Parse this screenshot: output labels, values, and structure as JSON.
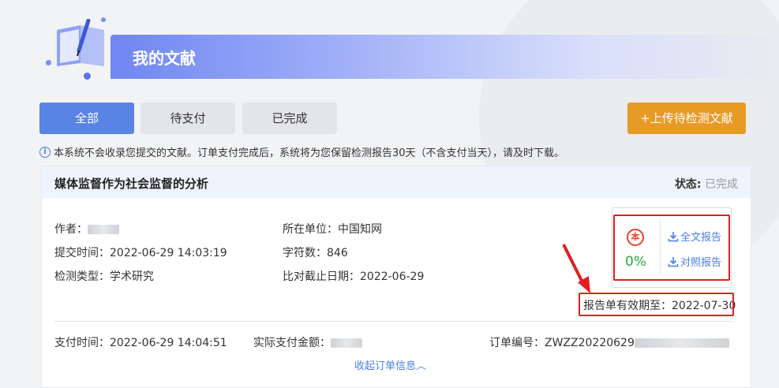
{
  "header": {
    "title": "我的文献"
  },
  "tabs": [
    {
      "label": "全部",
      "active": true
    },
    {
      "label": "待支付",
      "active": false
    },
    {
      "label": "已完成",
      "active": false
    }
  ],
  "upload_button": {
    "label": "+上传待检测文献"
  },
  "notice": {
    "text": "本系统不会收录您提交的文献。订单支付完成后，系统将为您保留检测报告30天（不含支付当天），请及时下载。"
  },
  "order": {
    "title": "媒体监督作为社会监督的分析",
    "status_label": "状态:",
    "status_value": "已完成",
    "author_label": "作者：",
    "org_label": "所在单位：",
    "org_value": "中国知网",
    "submit_time_label": "提交时间：",
    "submit_time_value": "2022-06-29 14:03:19",
    "char_count_label": "字符数：",
    "char_count_value": "846",
    "detect_type_label": "检测类型：",
    "detect_type_value": "学术研究",
    "deadline_label": "比对截止日期：",
    "deadline_value": "2022-06-29",
    "report": {
      "similarity": "0%",
      "seal_char": "本",
      "full_report_label": "全文报告",
      "compare_report_label": "对照报告"
    },
    "validity_label": "报告单有效期至：",
    "validity_value": "2022-07-30",
    "pay_time_label": "支付时间：",
    "pay_time_value": "2022-06-29 14:04:51",
    "amount_label": "实际支付金额：",
    "order_no_label": "订单编号：",
    "order_no_value": "ZWZZ20220629",
    "collapse_label": "收起订单信息",
    "collapse_icon": "chevron-up-icon"
  },
  "colors": {
    "primary": "#5a83e6",
    "upload": "#e89a26",
    "success": "#27a844",
    "highlight": "#e02020",
    "link": "#4a7ee6"
  }
}
